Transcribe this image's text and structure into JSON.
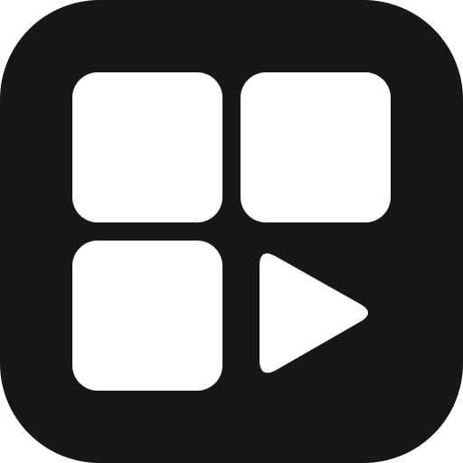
{
  "icon": {
    "name": "app-grid-play-icon",
    "background_color": "#17171a",
    "foreground_color": "#ffffff",
    "tiles": [
      {
        "name": "tile-top-left",
        "shape": "rounded-square"
      },
      {
        "name": "tile-top-right",
        "shape": "rounded-square"
      },
      {
        "name": "tile-bottom-left",
        "shape": "rounded-square"
      },
      {
        "name": "tile-bottom-right",
        "shape": "play-triangle"
      }
    ]
  }
}
